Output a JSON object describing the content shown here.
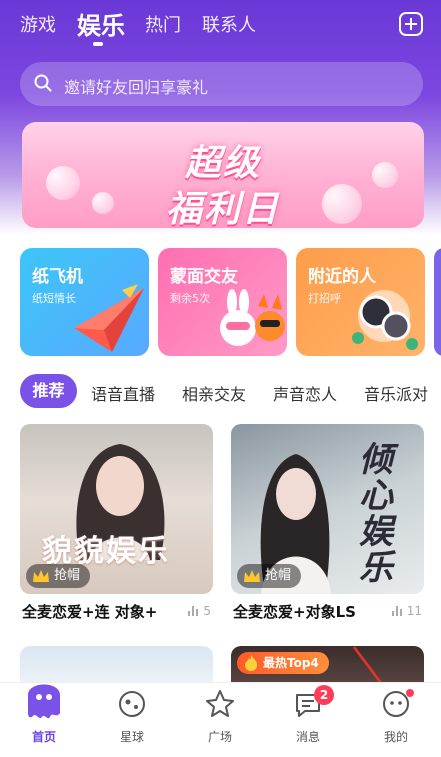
{
  "topnav": {
    "tabs": [
      {
        "label": "游戏",
        "active": false
      },
      {
        "label": "娱乐",
        "active": true
      },
      {
        "label": "热门",
        "active": false
      },
      {
        "label": "联系人",
        "active": false
      }
    ],
    "add_icon": "add-square-icon"
  },
  "search": {
    "placeholder": "邀请好友回归享豪礼",
    "icon": "search-icon"
  },
  "banner": {
    "line1": "超级",
    "line2": "福利日"
  },
  "cards": [
    {
      "title": "纸飞机",
      "subtitle": "纸短情长",
      "icon": "paper-plane-icon"
    },
    {
      "title": "蒙面交友",
      "subtitle": "剩余5次",
      "icon": "masked-animals-icon"
    },
    {
      "title": "附近的人",
      "subtitle": "打招呼",
      "icon": "avatars-icon"
    }
  ],
  "categories": [
    "推荐",
    "语音直播",
    "相亲交友",
    "声音恋人",
    "音乐派对"
  ],
  "posts": [
    {
      "title": "全麦恋爱+连 对象+",
      "badge": "抢帽",
      "count": "5",
      "cover_text": "貌貌娱乐"
    },
    {
      "title": "全麦恋爱+对象LS",
      "badge": "抢帽",
      "count": "11",
      "cover_text": "倾心娱乐"
    }
  ],
  "posts_row2": [
    {
      "badge": ""
    },
    {
      "badge": "最热Top4"
    }
  ],
  "bottom_nav": [
    {
      "label": "首页",
      "active": true,
      "icon": "home-octopus-icon"
    },
    {
      "label": "星球",
      "active": false,
      "icon": "planet-icon"
    },
    {
      "label": "广场",
      "active": false,
      "icon": "star-icon"
    },
    {
      "label": "消息",
      "active": false,
      "icon": "message-icon",
      "badge": "2"
    },
    {
      "label": "我的",
      "active": false,
      "icon": "profile-face-icon"
    }
  ],
  "colors": {
    "primary": "#7b52e8",
    "badge_red": "#ff3d5b"
  }
}
